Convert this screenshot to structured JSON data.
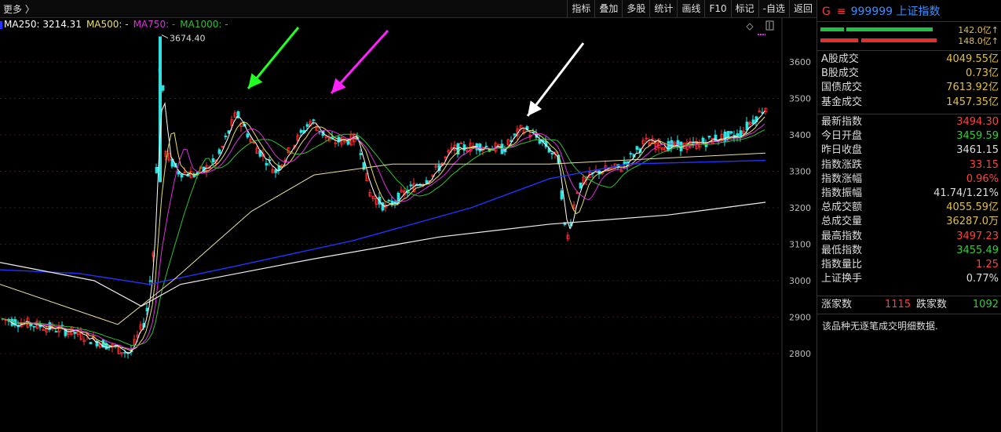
{
  "toolbar": {
    "more_label": "更多 〉",
    "tabs": [
      "指标",
      "叠加",
      "多股",
      "统计",
      "画线",
      "F10",
      "标记",
      "-自选",
      "返回"
    ]
  },
  "ma_legend": {
    "ma250": "MA250: 3214.31",
    "ma500": "MA500: -",
    "ma750": "MA750: -",
    "ma1000": "MA1000: -"
  },
  "peak_label": "3674.40",
  "y_axis_ticks": [
    "3600",
    "3500",
    "3400",
    "3300",
    "3200",
    "3100",
    "3000",
    "2900",
    "2800"
  ],
  "colors": {
    "up": "#ff3333",
    "down": "#33e0e0",
    "ma_white": "#ffffff",
    "ma_yellow": "#e8e060",
    "ma_magenta": "#e030e0",
    "ma_green": "#30c030",
    "ma_blue": "#2233ff",
    "arrow_green": "#22ff22",
    "arrow_magenta": "#ff22ff",
    "arrow_white": "#ffffff"
  },
  "quote": {
    "g_mark": "G",
    "eq_mark": "≡",
    "code": "999999",
    "name": "上证指数",
    "bar_top_amount": "142.0亿↑",
    "bar_bottom_amount": "148.0亿↑"
  },
  "stats": [
    {
      "label": "A股成交",
      "value": "4049.55亿",
      "color": "#e0c040"
    },
    {
      "label": "B股成交",
      "value": "0.73亿",
      "color": "#e0c040"
    },
    {
      "label": "国债成交",
      "value": "7613.92亿",
      "color": "#e0c040"
    },
    {
      "label": "基金成交",
      "value": "1457.35亿",
      "color": "#e0c040"
    }
  ],
  "stats2": [
    {
      "label": "最新指数",
      "value": "3494.30",
      "color": "#ff4040"
    },
    {
      "label": "今日开盘",
      "value": "3459.59",
      "color": "#30d030"
    },
    {
      "label": "昨日收盘",
      "value": "3461.15",
      "color": "#dddddd"
    },
    {
      "label": "指数涨跌",
      "value": "33.15",
      "color": "#ff4040"
    },
    {
      "label": "指数涨幅",
      "value": "0.96%",
      "color": "#ff4040"
    },
    {
      "label": "指数振幅",
      "value": "41.74/1.21%",
      "color": "#dddddd"
    },
    {
      "label": "总成交额",
      "value": "4055.59亿",
      "color": "#e0c040"
    },
    {
      "label": "总成交量",
      "value": "36287.0万",
      "color": "#e0c040"
    },
    {
      "label": "最高指数",
      "value": "3497.23",
      "color": "#ff4040"
    },
    {
      "label": "最低指数",
      "value": "3455.49",
      "color": "#30d030"
    },
    {
      "label": "指数量比",
      "value": "1.25",
      "color": "#ff4040"
    },
    {
      "label": "上证换手",
      "value": "0.77%",
      "color": "#dddddd"
    }
  ],
  "updown": {
    "up_label": "涨家数",
    "up_value": "1115",
    "down_label": "跌家数",
    "down_value": "1092"
  },
  "note": "该品种无逐笔成交明细数据."
}
